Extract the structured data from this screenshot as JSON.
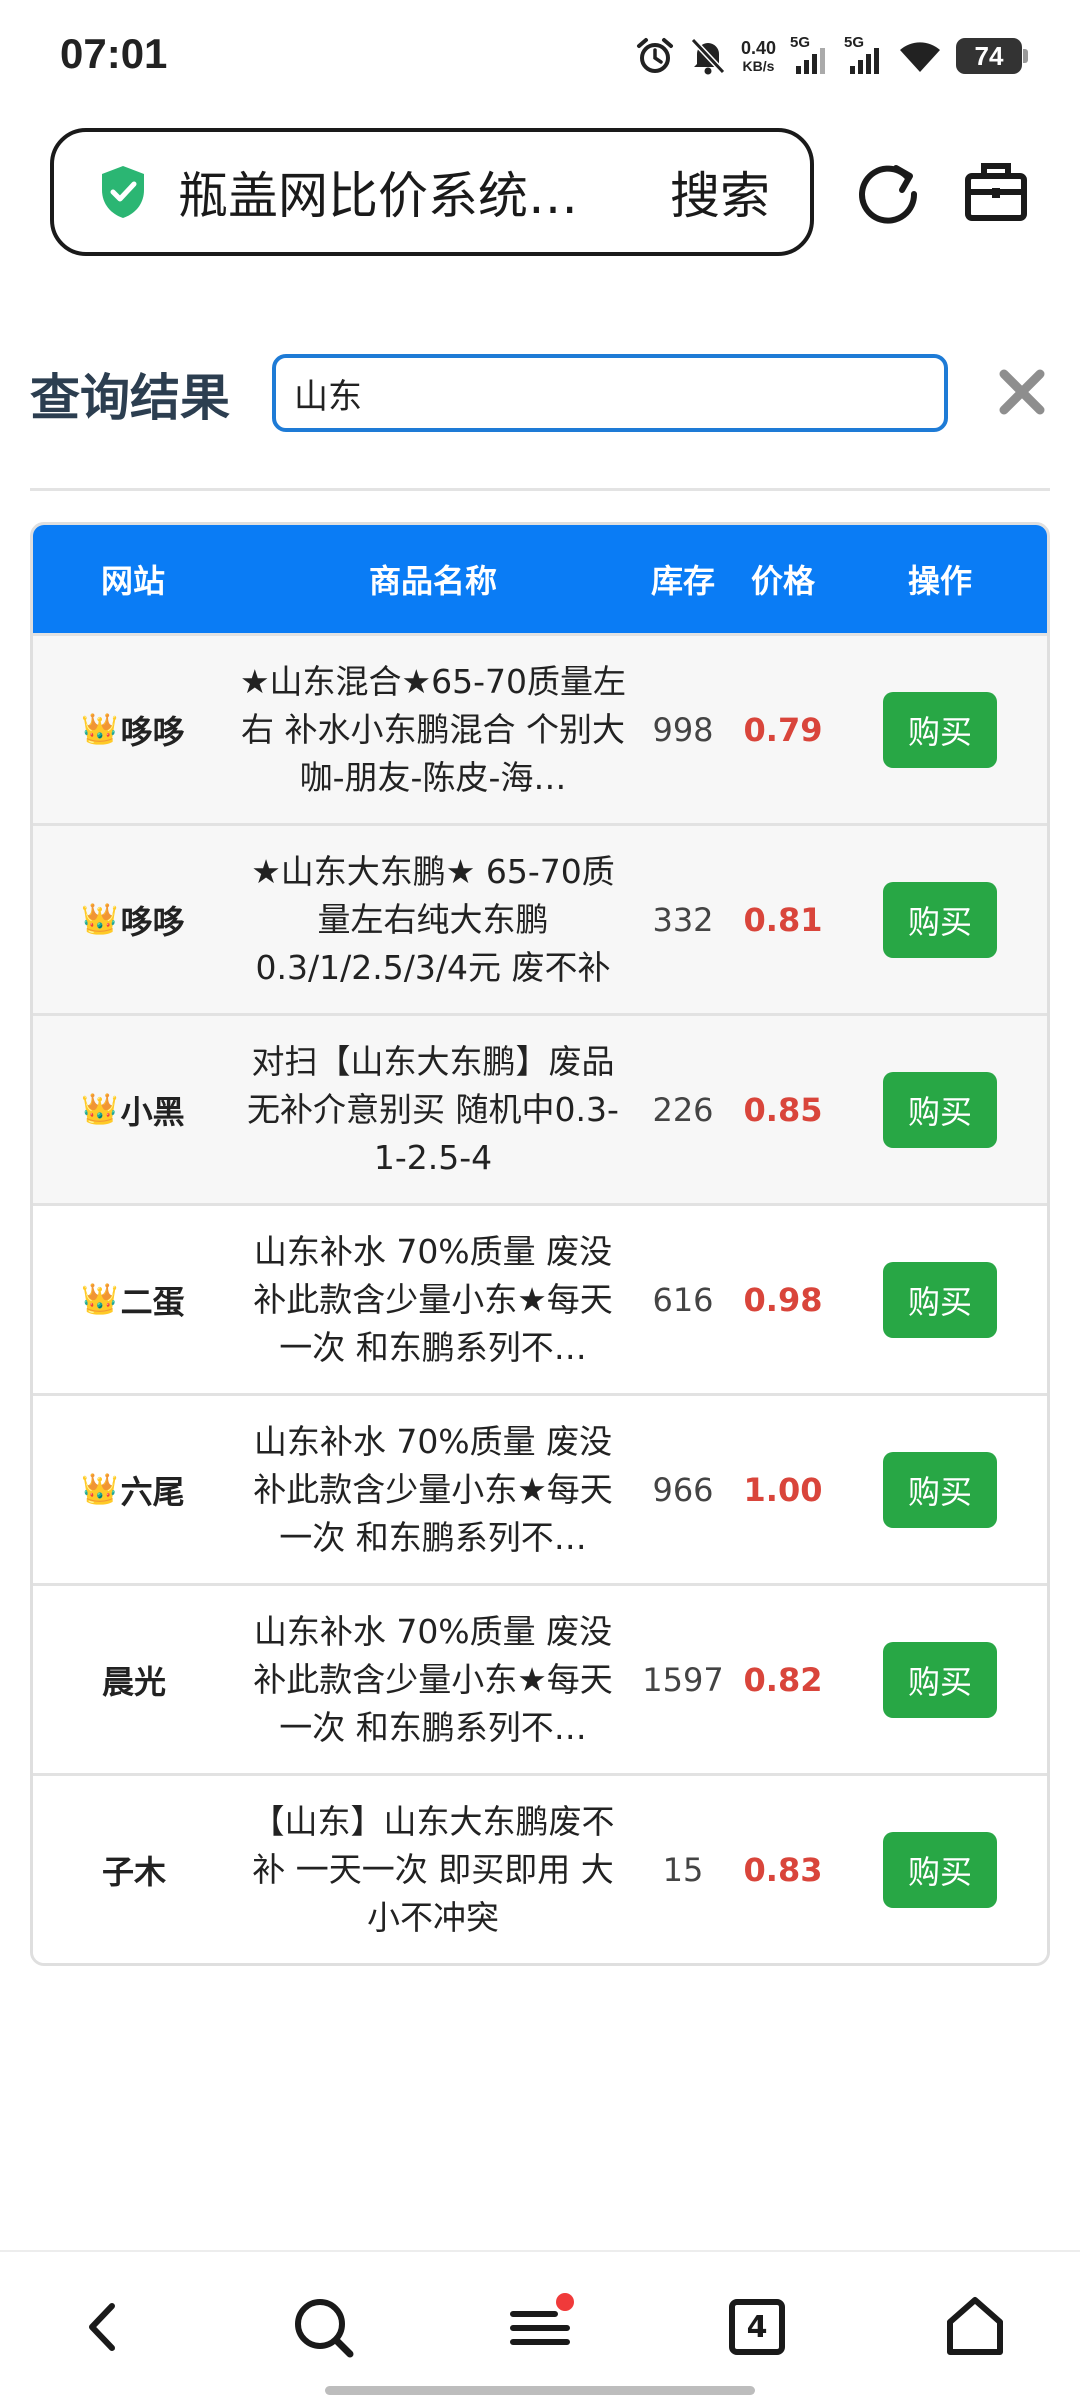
{
  "status_bar": {
    "time": "07:01",
    "net_speed_value": "0.40",
    "net_speed_unit": "KB/s",
    "signal1_label": "5G",
    "signal2_label": "5G",
    "battery": "74"
  },
  "address_bar": {
    "title": "瓶盖网比价系统…",
    "search_label": "搜索"
  },
  "query": {
    "label": "查询结果",
    "input_value": "山东"
  },
  "table": {
    "headers": {
      "site": "网站",
      "name": "商品名称",
      "stock": "库存",
      "price": "价格",
      "action": "操作"
    },
    "rows": [
      {
        "crown": "👑",
        "site": "哆哆",
        "name": "★山东混合★65-70质量左右 补水小东鹏混合 个别大咖-朋友-陈皮-海…",
        "stock": "998",
        "price": "0.79",
        "action": "购买"
      },
      {
        "crown": "👑",
        "site": "哆哆",
        "name": "★山东大东鹏★ 65-70质量左右纯大东鹏0.3/1/2.5/3/4元 废不补",
        "stock": "332",
        "price": "0.81",
        "action": "购买"
      },
      {
        "crown": "👑",
        "site": "小黑",
        "name": "对扫【山东大东鹏】废品无补介意别买 随机中0.3-1-2.5-4",
        "stock": "226",
        "price": "0.85",
        "action": "购买"
      },
      {
        "crown": "👑",
        "site": "二蛋",
        "name": "山东补水 70%质量 废没补此款含少量小东★每天一次 和东鹏系列不…",
        "stock": "616",
        "price": "0.98",
        "action": "购买"
      },
      {
        "crown": "👑",
        "site": "六尾",
        "name": "山东补水 70%质量 废没补此款含少量小东★每天一次 和东鹏系列不…",
        "stock": "966",
        "price": "1.00",
        "action": "购买"
      },
      {
        "crown": "",
        "site": "晨光",
        "name": "山东补水 70%质量 废没补此款含少量小东★每天一次 和东鹏系列不…",
        "stock": "1597",
        "price": "0.82",
        "action": "购买"
      },
      {
        "crown": "",
        "site": "子木",
        "name": "【山东】山东大东鹏废不补 一天一次 即买即用 大小不冲突",
        "stock": "15",
        "price": "0.83",
        "action": "购买"
      }
    ]
  },
  "bottom_nav": {
    "tabs_count": "4"
  },
  "colors": {
    "header_blue": "#0a7cf5",
    "buy_green": "#28a745",
    "price_red": "#d9453b",
    "input_border": "#1e7bd6",
    "shield_green": "#2bb673"
  },
  "icons": [
    "alarm-icon",
    "mute-bell-icon",
    "signal-icon",
    "wifi-icon",
    "battery-icon",
    "shield-check-icon",
    "refresh-icon",
    "toolbox-icon",
    "close-icon",
    "back-icon",
    "search-icon",
    "menu-icon",
    "tabs-icon",
    "home-icon"
  ]
}
